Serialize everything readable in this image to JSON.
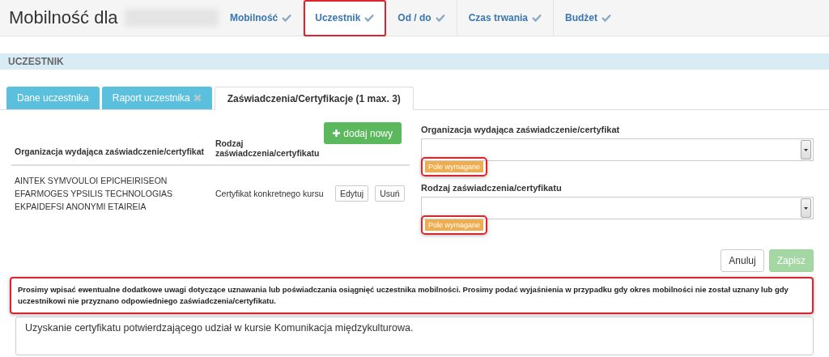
{
  "header": {
    "title": "Mobilność dla",
    "steps": [
      {
        "label": "Mobilność",
        "selected": false,
        "done": true,
        "highlighted": false
      },
      {
        "label": "Uczestnik",
        "selected": true,
        "done": true,
        "highlighted": true
      },
      {
        "label": "Od / do",
        "selected": false,
        "done": true,
        "highlighted": false
      },
      {
        "label": "Czas trwania",
        "selected": false,
        "done": true,
        "highlighted": false
      },
      {
        "label": "Budżet",
        "selected": false,
        "done": true,
        "highlighted": false
      }
    ]
  },
  "section": {
    "title": "UCZESTNIK"
  },
  "tabs": [
    {
      "label": "Dane uczestnika",
      "selected": false,
      "invalid": false
    },
    {
      "label": "Raport uczestnika",
      "selected": false,
      "invalid": true
    },
    {
      "label": "Zaświadczenia/Certyfikacje (1 max. 3)",
      "selected": true,
      "invalid": false
    }
  ],
  "add_button": {
    "label": "dodaj nowy"
  },
  "table": {
    "columns": [
      "Organizacja wydająca zaświadczenie/certyfikat",
      "Rodzaj zaświadczenia/certyfikatu"
    ],
    "rows": [
      {
        "organization": "AINTEK SYMVOULOI EPICHEIRISEON EFARMOGES YPSILIS TECHNOLOGIAS EKPAIDEFSI ANONYMI ETAIREIA",
        "type": "Certyfikat konkretnego kursu",
        "actions": [
          "Edytuj",
          "Usuń"
        ]
      }
    ]
  },
  "form": {
    "fields": [
      {
        "label": "Organizacja wydająca zaświadczenie/certyfikat",
        "error": "Pole wymagane",
        "highlighted": true
      },
      {
        "label": "Rodzaj zaświadczenia/certyfikatu",
        "error": "Pole wymagane",
        "highlighted": true
      }
    ],
    "buttons": [
      {
        "label": "Anuluj",
        "kind": "default",
        "disabled": false
      },
      {
        "label": "Zapisz",
        "kind": "primary",
        "disabled": true
      }
    ]
  },
  "note": {
    "text": "Prosimy wpisać ewentualne dodatkowe uwagi dotyczące uznawania lub poświadczania osiągnięć uczestnika mobilności. Prosimy podać wyjaśnienia w przypadku gdy okres mobilności nie został uznany lub gdy uczestnikowi nie przyznano odpowiedniego zaświadczenia/certyfikatu.",
    "highlighted": true
  },
  "comment": {
    "value": "Uzyskanie certyfikatu potwierdzającego udział w kursie Komunikacja międzykulturowa."
  }
}
